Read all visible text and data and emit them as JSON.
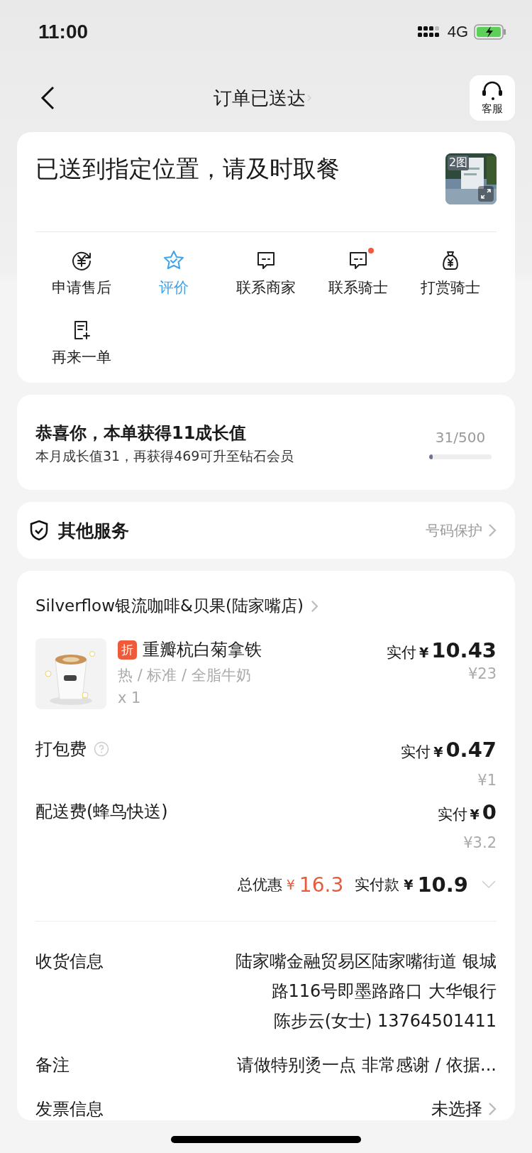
{
  "status_bar": {
    "time": "11:00",
    "network": "4G"
  },
  "nav": {
    "title": "订单已送达",
    "service_label": "客服"
  },
  "status_card": {
    "message": "已送到指定位置，请及时取餐",
    "photo_count": "2图",
    "actions": [
      {
        "kind": "refund",
        "label": "申请售后",
        "active": false,
        "badge": false
      },
      {
        "kind": "star",
        "label": "评价",
        "active": true,
        "badge": false
      },
      {
        "kind": "chat",
        "label": "联系商家",
        "active": false,
        "badge": false
      },
      {
        "kind": "chat",
        "label": "联系骑士",
        "active": false,
        "badge": true
      },
      {
        "kind": "moneybag",
        "label": "打赏骑士",
        "active": false,
        "badge": false
      },
      {
        "kind": "reorder",
        "label": "再来一单",
        "active": false,
        "badge": false
      }
    ]
  },
  "growth": {
    "title": "恭喜你，本单获得11成长值",
    "subtitle": "本月成长值31，再获得469可升至钻石会员",
    "reading": "31/500",
    "level": 0.062
  },
  "services": {
    "title": "其他服务",
    "link": "号码保护"
  },
  "order": {
    "store": "Silverflow银流咖啡&贝果(陆家嘴店)",
    "item": {
      "tag": "折",
      "name": "重瓣杭白菊拿铁",
      "specs": "热 / 标准 / 全脂牛奶",
      "quantity": "x 1",
      "paid_label": "实付",
      "currency": "¥",
      "amount": "10.43",
      "original": "¥23"
    },
    "fees": [
      {
        "label": "打包费",
        "help": true,
        "paid_label": "实付",
        "currency": "¥",
        "amount": "0.47",
        "original": "¥1"
      },
      {
        "label": "配送费(蜂鸟快送)",
        "help": false,
        "paid_label": "实付",
        "currency": "¥",
        "amount": "0",
        "original": "¥3.2"
      }
    ],
    "total": {
      "discount_label": "总优惠",
      "discount_currency": "¥",
      "discount": "16.3",
      "paid_label": "实付款",
      "currency": "¥",
      "amount": "10.9"
    },
    "info": [
      {
        "label": "收货信息",
        "lines": [
          "陆家嘴金融贸易区陆家嘴街道 银城",
          "路116号即墨路路口 大华银行",
          "陈步云(女士) 13764501411"
        ],
        "arrow": false
      },
      {
        "label": "备注",
        "lines": [
          "请做特别烫一点 非常感谢 / 依据..."
        ],
        "arrow": false
      },
      {
        "label": "发票信息",
        "lines": [
          "未选择"
        ],
        "arrow": true
      }
    ]
  }
}
